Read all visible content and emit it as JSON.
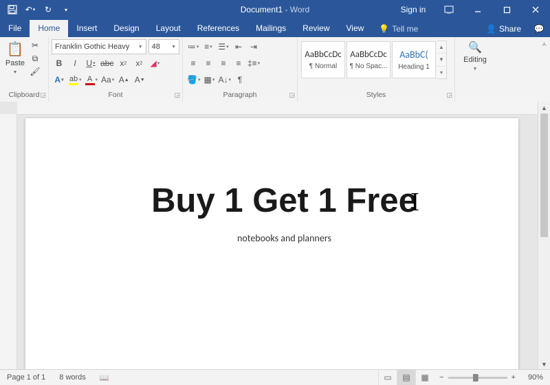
{
  "title": {
    "doc": "Document1",
    "app": "Word",
    "sep": " - "
  },
  "qat": {
    "save": "save",
    "undo": "undo",
    "redo": "redo",
    "customize": "customize"
  },
  "titleright": {
    "signin": "Sign in"
  },
  "tabs": {
    "file": "File",
    "home": "Home",
    "insert": "Insert",
    "design": "Design",
    "layout": "Layout",
    "references": "References",
    "mailings": "Mailings",
    "review": "Review",
    "view": "View",
    "tellme": "Tell me",
    "share": "Share"
  },
  "ribbon": {
    "clipboard": {
      "label": "Clipboard",
      "paste": "Paste"
    },
    "font": {
      "label": "Font",
      "name": "Franklin Gothic Heavy",
      "size": "48"
    },
    "paragraph": {
      "label": "Paragraph"
    },
    "styles": {
      "label": "Styles",
      "preview": "AaBbCcDc",
      "preview3": "AaBbC(",
      "s1": "¶ Normal",
      "s2": "¶ No Spac...",
      "s3": "Heading 1"
    },
    "editing": {
      "label": "Editing"
    }
  },
  "document": {
    "headline": "Buy 1 Get 1 Free",
    "sub": "notebooks and planners"
  },
  "status": {
    "page": "Page 1 of 1",
    "words": "8 words",
    "zoom": "90%"
  }
}
